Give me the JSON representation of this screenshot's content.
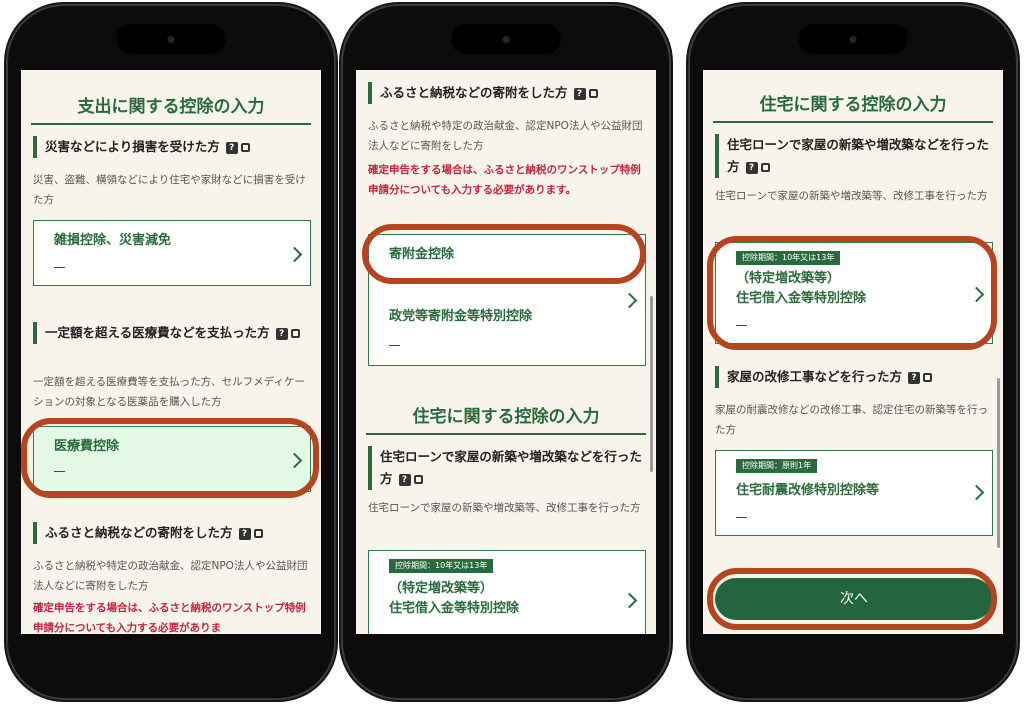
{
  "phone1": {
    "section_title": "支出に関する控除の入力",
    "disaster": {
      "heading": "災害などにより損害を受けた方",
      "description": "災害、盗難、横領などにより住宅や家財などに損害を受けた方",
      "card_label": "雑損控除、災害減免",
      "card_value": "—"
    },
    "medical": {
      "heading": "一定額を超える医療費などを支払った方",
      "description": "一定額を超える医療費等を支払った方、セルフメディケーションの対象となる医薬品を購入した方",
      "card_label": "医療費控除",
      "card_value": "—"
    },
    "donation": {
      "heading": "ふるさと納税などの寄附をした方",
      "description": "ふるさと納税や特定の政治献金、認定NPO法人や公益財団法人などに寄附をした方",
      "warning": "確定申告をする場合は、ふるさと納税のワンストップ特例申請分についても入力する必要がありま"
    }
  },
  "phone2": {
    "donation": {
      "heading": "ふるさと納税などの寄附をした方",
      "description": "ふるさと納税や特定の政治献金、認定NPO法人や公益財団法人などに寄附をした方",
      "warning": "確定申告をする場合は、ふるさと納税のワンストップ特例申請分についても入力する必要があります。",
      "card1_label": "寄附金控除",
      "card2_label": "政党等寄附金等特別控除",
      "card2_value": "—"
    },
    "section_title": "住宅に関する控除の入力",
    "housing": {
      "heading": "住宅ローンで家屋の新築や増改築などを行った方",
      "description": "住宅ローンで家屋の新築や増改築等、改修工事を行った方",
      "badge": "控除期間：10年又は13年",
      "card_label_line1": "（特定増改築等）",
      "card_label_line2": "住宅借入金等特別控除",
      "card_value": "—"
    }
  },
  "phone3": {
    "section_title": "住宅に関する控除の入力",
    "housing": {
      "heading": "住宅ローンで家屋の新築や増改築などを行った方",
      "description": "住宅ローンで家屋の新築や増改築等、改修工事を行った方",
      "badge": "控除期間：10年又は13年",
      "card_label_line1": "（特定増改築等）",
      "card_label_line2": "住宅借入金等特別控除",
      "card_value": "—"
    },
    "renovation": {
      "heading": "家屋の改修工事などを行った方",
      "description": "家屋の耐震改修などの改修工事、認定住宅の新築等を行った方",
      "badge": "控除期間：原則1年",
      "card_label": "住宅耐震改修特別控除等",
      "card_value": "—"
    },
    "next_button": "次へ"
  },
  "icons": {
    "help": "?",
    "help_icon_name": "question-icon",
    "book_icon_name": "book-icon",
    "chevron_icon_name": "chevron-right-icon"
  },
  "colors": {
    "brand_green": "#2a6b3d",
    "screen_background": "#f9f4eb",
    "warning_red": "#c2263f",
    "highlight_orange": "#b5441f",
    "selected_card_mint": "#e4f8e6"
  }
}
